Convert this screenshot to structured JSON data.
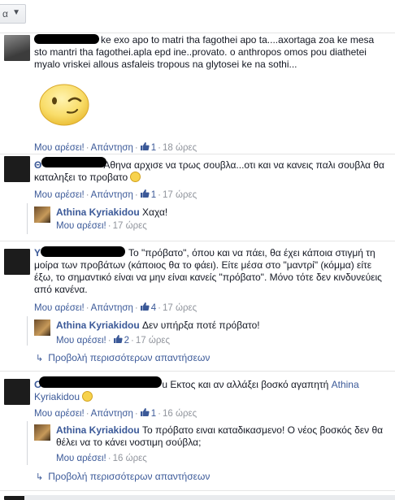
{
  "sort": {
    "label": "α"
  },
  "comments": [
    {
      "text": "ke exo apo to matri tha fagothei apo ta....axortaga zoa ke mesa sto mantri tha fagothei.apla epd ine..provato. o anthropos omos pou diathetei myalo vriskei allous asfaleis tropous na glytosei ke na sothi...",
      "like_label": "Μου αρέσει!",
      "reply_label": "Απάντηση",
      "likes": "1",
      "time": "18 ώρες",
      "sticker": "wink-face"
    },
    {
      "name_prefix": "Θ",
      "text": "Αθηνα αρχισε να τρως σουβλα...οτι και να κανεις παλι σουβλα θα καταληξει το προβατο",
      "like_label": "Μου αρέσει!",
      "reply_label": "Απάντηση",
      "likes": "1",
      "time": "17 ώρες",
      "replies": [
        {
          "name": "Athina Kyriakidou",
          "text": "Χαχα!",
          "like_label": "Μου αρέσει!",
          "time": "17 ώρες"
        }
      ]
    },
    {
      "name_prefix": "Y",
      "text": "Το \"πρόβατο\", όπου και να πάει, θα έχει κάποια στιγμή τη μοίρα των προβάτων (κάποιος θα το φάει). Είτε μέσα στο \"μαντρί\" (κόμμα) είτε έξω, το σημαντικό είναι να μην είναι κανείς \"πρόβατο\". Μόνο τότε δεν κινδυνεύεις από κανένα.",
      "like_label": "Μου αρέσει!",
      "reply_label": "Απάντηση",
      "likes": "4",
      "time": "17 ώρες",
      "replies": [
        {
          "name": "Athina Kyriakidou",
          "text": "Δεν υπήρξα ποτέ πρόβατο!",
          "like_label": "Μου αρέσει!",
          "likes": "2",
          "time": "17 ώρες"
        }
      ],
      "more_replies": "Προβολή περισσότερων απαντήσεων"
    },
    {
      "name_prefix": "O",
      "text_before": "u Εκτος και αν αλλάξει βοσκό αγαπητή",
      "mention": "Athina",
      "mention_line2": "Kyriakidou",
      "like_label": "Μου αρέσει!",
      "reply_label": "Απάντηση",
      "likes": "1",
      "time": "16 ώρες",
      "replies": [
        {
          "name": "Athina Kyriakidou",
          "text": "Το πρόβατο ειναι καταδικασμενο! Ο νέος βοσκός δεν θα θέλει να το κάνει νοστιμη σούβλα;",
          "like_label": "Μου αρέσει!",
          "time": "16 ώρες"
        }
      ],
      "more_replies": "Προβολή περισσότερων απαντήσεων"
    }
  ]
}
